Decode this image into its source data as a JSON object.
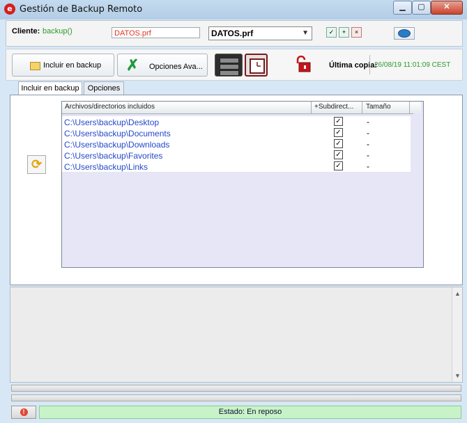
{
  "window": {
    "title": "Gestión de Backup Remoto"
  },
  "client": {
    "label": "Cliente:",
    "value": "backup()",
    "file_name": "DATOS.prf",
    "selected_profile": "DATOS.prf"
  },
  "toolbar": {
    "include_button": "Incluir en backup",
    "options_button": "Opciones Ava...",
    "last_copy_label": "Última copia:",
    "last_copy_value": "26/08/19 11:01:09 CEST"
  },
  "tabs": [
    {
      "label": "Incluir en backup",
      "active": true
    },
    {
      "label": "Opciones",
      "active": false
    }
  ],
  "list": {
    "columns": [
      "Archivos/directorios incluidos",
      "+Subdirect...",
      "Tamaño"
    ],
    "rows": [
      {
        "path": "C:\\Users\\backup\\Desktop",
        "subdirs": true,
        "size": "-"
      },
      {
        "path": "C:\\Users\\backup\\Documents",
        "subdirs": true,
        "size": "-"
      },
      {
        "path": "C:\\Users\\backup\\Downloads",
        "subdirs": true,
        "size": "-"
      },
      {
        "path": "C:\\Users\\backup\\Favorites",
        "subdirs": true,
        "size": "-"
      },
      {
        "path": "C:\\Users\\backup\\Links",
        "subdirs": true,
        "size": "-"
      }
    ]
  },
  "status": {
    "text": "Estado: En reposo"
  },
  "colors": {
    "accent_green": "#2a9a2a",
    "path_blue": "#2449c9",
    "status_green": "#c8f3c8",
    "alert_red": "#d51f1f"
  },
  "icons": [
    "app-logo-icon",
    "minimize-icon",
    "maximize-icon",
    "close-icon",
    "folder-icon",
    "wrench-icon",
    "server-icon",
    "clock-icon",
    "unlock-icon",
    "eye-icon",
    "refresh-icon",
    "stop-icon"
  ]
}
